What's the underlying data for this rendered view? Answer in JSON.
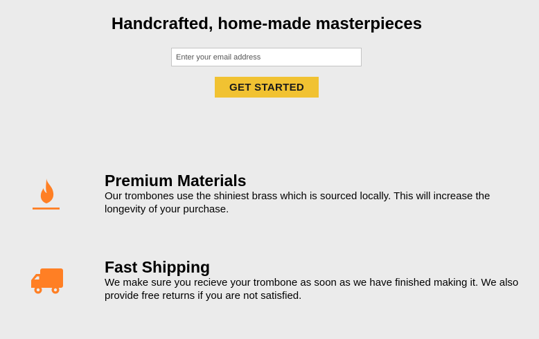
{
  "hero": {
    "title": "Handcrafted, home-made masterpieces",
    "email_placeholder": "Enter your email address",
    "cta_label": "GET STARTED"
  },
  "features": [
    {
      "icon": "fire-icon",
      "title": "Premium Materials",
      "description": "Our trombones use the shiniest brass which is sourced locally. This will increase the longevity of your purchase."
    },
    {
      "icon": "truck-icon",
      "title": "Fast Shipping",
      "description": "We make sure you recieve your trombone as soon as we have finished making it. We also provide free returns if you are not satisfied."
    }
  ],
  "colors": {
    "background": "#ebebeb",
    "accent_yellow": "#f1c232",
    "icon_orange": "#ff7f24"
  }
}
